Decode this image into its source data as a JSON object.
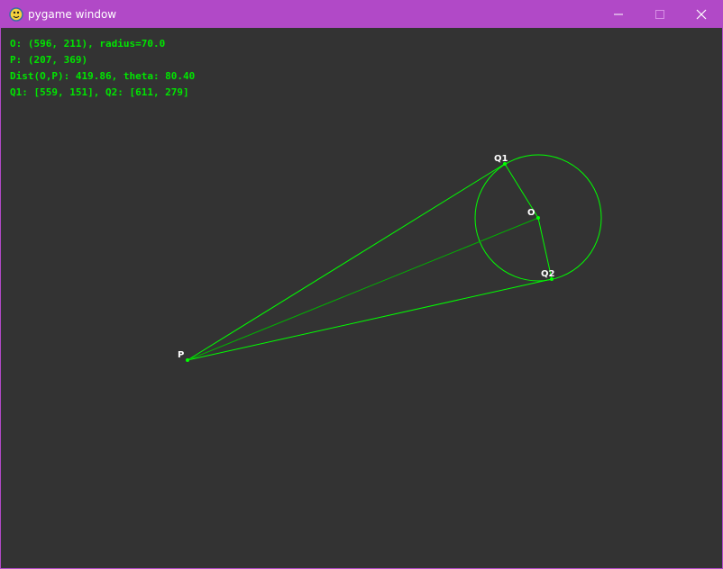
{
  "window": {
    "title": "pygame window",
    "controls": {
      "minimize_icon": "minimize-icon",
      "maximize_icon": "maximize-icon",
      "close_icon": "close-icon"
    },
    "titlebar_color": "#b149c7",
    "background_color": "#333333"
  },
  "hud": {
    "line1": "O: (596, 211), radius=70.0",
    "line2": "P: (207, 369)",
    "line3": "Dist(O,P): 419.86, theta: 80.40",
    "line4": "Q1: [559, 151], Q2: [611, 279]",
    "color": "#00e600"
  },
  "scene": {
    "circle_center_label": "O",
    "point_label": "P",
    "tangent1_label": "Q1",
    "tangent2_label": "Q2",
    "line_color": "#00ff00"
  }
}
